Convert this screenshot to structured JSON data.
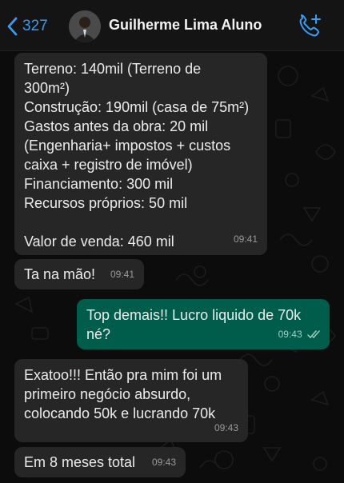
{
  "header": {
    "back_count": "327",
    "contact_name": "Guilherme Lima Aluno",
    "icons": {
      "back": "chevron-left-icon",
      "call": "add-call-icon"
    }
  },
  "colors": {
    "accent": "#3b9cf0",
    "incoming_bubble": "#262626",
    "outgoing_bubble": "#005c4b",
    "background": "#0c0c0c"
  },
  "messages": [
    {
      "direction": "in",
      "lines": [
        "Terreno: 140mil (Terreno de",
        "300m²)",
        "Construção: 190mil (casa de 75m²)",
        "Gastos antes da obra: 20 mil",
        "(Engenharia+ impostos + custos",
        "caixa + registro de imóvel)",
        "Financiamento:  300 mil",
        "Recursos próprios: 50 mil",
        "",
        "Valor de venda: 460 mil"
      ],
      "time": "09:41"
    },
    {
      "direction": "in",
      "text": "Ta na mão!",
      "time": "09:41"
    },
    {
      "direction": "out",
      "lines": [
        "Top demais!! Lucro liquido de 70k",
        "né?"
      ],
      "time": "09:43",
      "status": "read"
    },
    {
      "direction": "in",
      "lines": [
        "Exatoo!!! Então pra mim foi um",
        "primeiro negócio absurdo,",
        "colocando 50k e lucrando 70k"
      ],
      "time": "09:43"
    },
    {
      "direction": "in",
      "text": "Em 8 meses total",
      "time": "09:43"
    }
  ]
}
